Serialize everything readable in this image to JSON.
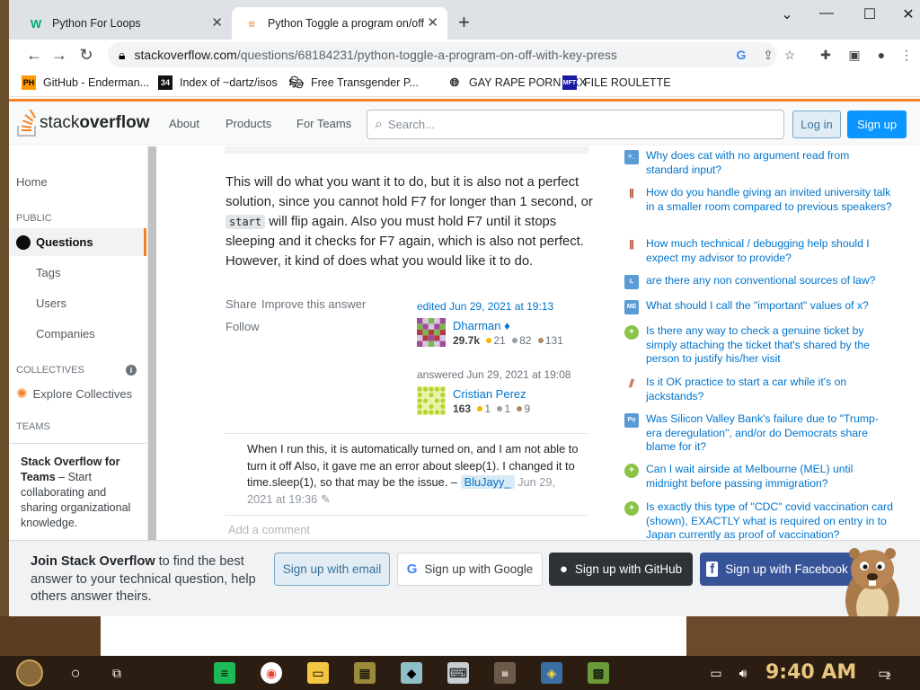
{
  "browser": {
    "tabs": [
      {
        "title": "Python For Loops",
        "favicon": "w3schools-icon"
      },
      {
        "title": "Python Toggle a program on/off",
        "favicon": "stackoverflow-icon"
      }
    ],
    "url_host": "stackoverflow.com",
    "url_path": "/questions/68184231/python-toggle-a-program-on-off-with-key-press",
    "bookmarks": [
      {
        "label": "GitHub - Enderman...",
        "icon": "PH"
      },
      {
        "label": "Index of ~dartz/isos",
        "icon": "34"
      },
      {
        "label": "Free Transgender P...",
        "icon": "mask-icon"
      },
      {
        "label": "GAY RAPE PORN XXX",
        "icon": "globe-icon"
      },
      {
        "label": "FILE ROULETTE",
        "icon": "MFT"
      }
    ]
  },
  "so_header": {
    "logo_part1": "stack",
    "logo_part2": "overflow",
    "nav": [
      "About",
      "Products",
      "For Teams"
    ],
    "search_placeholder": "Search...",
    "login": "Log in",
    "signup": "Sign up"
  },
  "leftnav": {
    "home": "Home",
    "public": "PUBLIC",
    "questions": "Questions",
    "tags": "Tags",
    "users": "Users",
    "companies": "Companies",
    "collectives": "COLLECTIVES",
    "explore_collectives": "Explore Collectives",
    "teams": "TEAMS",
    "teams_title": "Stack Overflow for Teams",
    "teams_text": "– Start collaborating and sharing organizational knowledge."
  },
  "answer": {
    "text_before": "This will do what you want it to do, but it is also not a perfect solution, since you cannot hold F7 for longer than 1 second, or",
    "code": "start",
    "text_after": "will flip again. Also you must hold F7 until it stops sleeping and it checks for F7 again, which is also not perfect. However, it kind of does what you would like it to do.",
    "share": "Share",
    "improve": "Improve this answer",
    "follow": "Follow",
    "edited_label": "edited",
    "edited_when": "Jun 29, 2021 at 19:13",
    "editor_name": "Dharman ♦",
    "editor_rep": "29.7k",
    "editor_gold": "21",
    "editor_silver": "82",
    "editor_bronze": "131",
    "answered_label": "answered",
    "answered_when": "Jun 29, 2021 at 19:08",
    "author_name": "Cristian Perez",
    "author_rep": "163",
    "author_gold": "1",
    "author_silver": "1",
    "author_bronze": "9"
  },
  "comment": {
    "text": "When I run this, it is automatically turned on, and I am not able to turn it off Also, it gave me an error about sleep(1). I changed it to time.sleep(1), so that may be the issue. –",
    "user": "BluJayy_",
    "date": "Jun 29, 2021 at 19:36"
  },
  "add_comment": "Add a comment",
  "hot_questions": [
    {
      "title": "Why does cat with no argument read from standard input?",
      "site": "unix"
    },
    {
      "title": "How do you handle giving an invited university talk in a smaller room compared to previous speakers?",
      "site": "academia"
    },
    {
      "title": "How much technical / debugging help should I expect my advisor to provide?",
      "site": "academia"
    },
    {
      "title": "are there any non conventional sources of law?",
      "site": "law"
    },
    {
      "title": "What should I call the \"important\" values of x?",
      "site": "math"
    },
    {
      "title": "Is there any way to check a genuine ticket by simply attaching the ticket that's shared by the person to justify his/her visit",
      "site": "travel"
    },
    {
      "title": "Is it OK practice to start a car while it's on jackstands?",
      "site": "mechanics"
    },
    {
      "title": "Was Silicon Valley Bank's failure due to \"Trump-era deregulation\", and/or do Democrats share blame for it?",
      "site": "politics"
    },
    {
      "title": "Can I wait airside at Melbourne (MEL) until midnight before passing immigration?",
      "site": "travel"
    },
    {
      "title": "Is exactly this type of \"CDC\" covid vaccination card (shown), EXACTLY what is required on entry in to Japan currently as proof of vaccination?",
      "site": "travel"
    }
  ],
  "join": {
    "bold": "Join Stack Overflow",
    "rest": "to find the best answer to your technical question, help others answer theirs.",
    "email": "Sign up with email",
    "google": "Sign up with Google",
    "github": "Sign up with GitHub",
    "facebook": "Sign up with Facebook"
  },
  "taskbar": {
    "clock": "9:40 AM",
    "notifications": "2"
  },
  "colors": {
    "so_orange": "#f48225",
    "so_blue": "#0a95ff",
    "link": "#0074cc"
  }
}
